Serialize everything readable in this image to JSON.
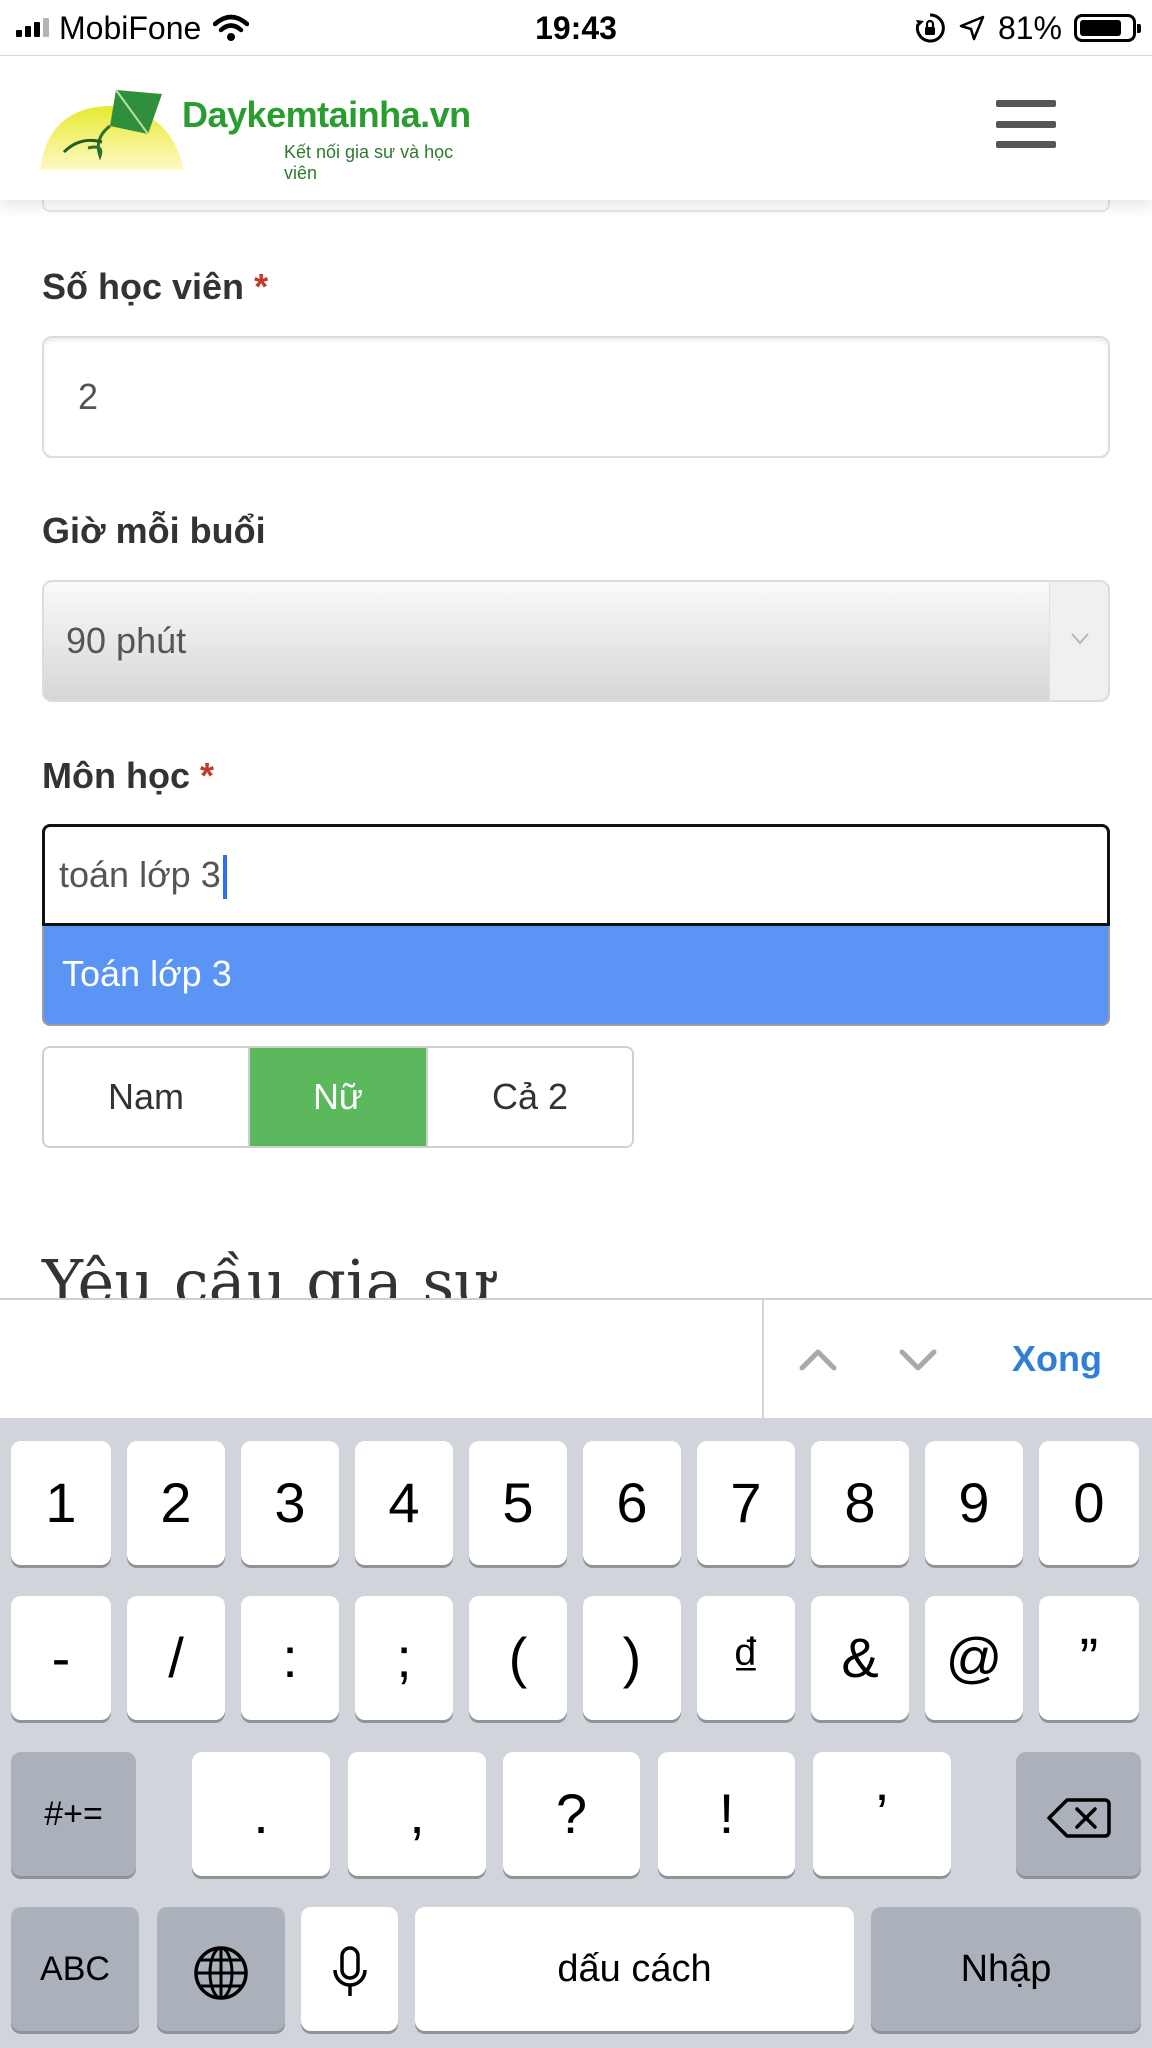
{
  "status_bar": {
    "carrier": "MobiFone",
    "time": "19:43",
    "battery_percent": "81%",
    "battery_level": 0.81
  },
  "header": {
    "brand": "Daykemtainha.vn",
    "tagline": "Kết nối gia sư và học viên"
  },
  "form": {
    "students": {
      "label": "Số học viên",
      "required_mark": "*",
      "value": "2"
    },
    "session_time": {
      "label": "Giờ mỗi buổi",
      "value": "90 phút"
    },
    "subject": {
      "label": "Môn học",
      "required_mark": "*",
      "value": "toán lớp 3",
      "suggestion": "Toán lớp 3"
    },
    "gender": {
      "options": [
        "Nam",
        "Nữ",
        "Cả 2"
      ],
      "selected": "Nữ"
    },
    "section_heading": "Yêu cầu gia sư"
  },
  "keyboard_accessory": {
    "done_label": "Xong"
  },
  "keyboard": {
    "row1": [
      "1",
      "2",
      "3",
      "4",
      "5",
      "6",
      "7",
      "8",
      "9",
      "0"
    ],
    "row2": [
      "-",
      "/",
      ":",
      ";",
      "(",
      ")",
      "₫",
      "&",
      "@",
      "”"
    ],
    "row3": {
      "toggle": "#+=",
      "keys": [
        ".",
        ",",
        "?",
        "!",
        "’"
      ]
    },
    "row4": {
      "abc": "ABC",
      "space": "dấu cách",
      "return": "Nhập"
    }
  },
  "colors": {
    "suggestion_bg": "#5a95f5",
    "selected_gender_bg": "#5cb85c",
    "required": "#c0392b",
    "link": "#2f7ed8"
  }
}
